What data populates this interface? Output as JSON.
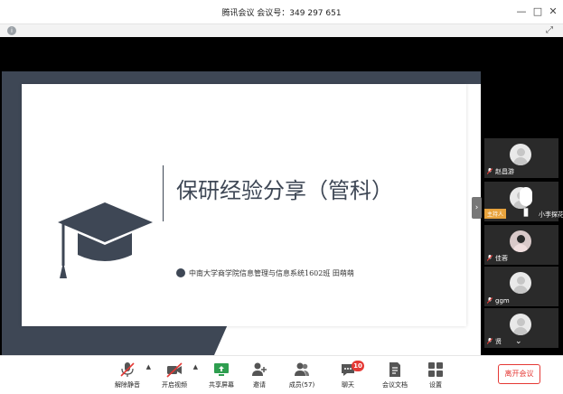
{
  "window": {
    "title": "腾讯会议  会议号：349 297 651",
    "minimize_icon": "minimize-icon",
    "maximize_icon": "maximize-icon",
    "close_icon": "close-icon"
  },
  "slide": {
    "title": "保研经验分享（管科）",
    "subtitle": "中南大学商学院信息管理与信息系统1602班     田萌萌"
  },
  "participants": [
    {
      "name": "赵昌游",
      "muted": true
    },
    {
      "host_badge": "主持人",
      "name": "小李探花",
      "muted": false
    },
    {
      "name": "佳蓉",
      "muted": true,
      "photo": true
    },
    {
      "name": "ggm",
      "muted": true
    },
    {
      "name": "贤",
      "muted": true
    }
  ],
  "toolbar": {
    "mute_label": "解除静音",
    "video_label": "开启视频",
    "share_label": "共享屏幕",
    "invite_label": "邀请",
    "members_label": "成员(57)",
    "chat_label": "聊天",
    "chat_badge": "10",
    "docs_label": "会议文档",
    "settings_label": "设置",
    "leave_label": "离开会议"
  },
  "colors": {
    "slide_dark": "#3e4755",
    "leave_red": "#e53935",
    "badge_red": "#e53935",
    "host_badge": "#e8a33d"
  }
}
